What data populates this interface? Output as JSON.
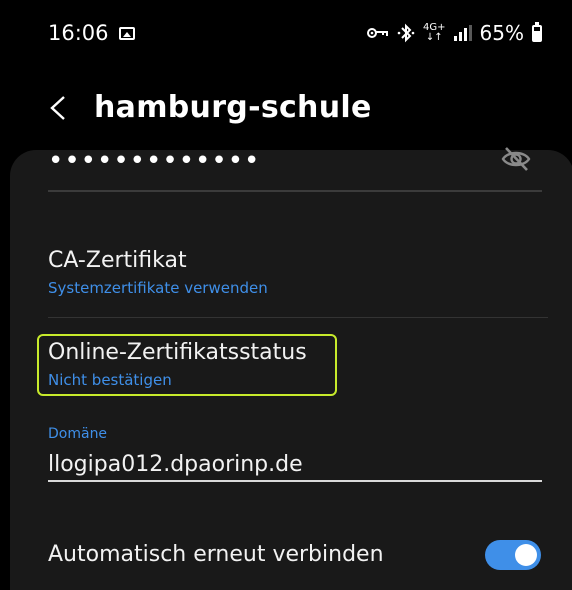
{
  "status_bar": {
    "time": "16:06",
    "battery_percent": "65%",
    "battery_level": 0.65,
    "network_label": "4G+",
    "icons": [
      "image-icon",
      "key-icon",
      "bluetooth-icon",
      "network-icon",
      "signal-icon",
      "battery-icon"
    ]
  },
  "header": {
    "back_icon": "chevron-left-icon",
    "title": "hamburg-schule"
  },
  "password": {
    "masked_value": "•••••••••••••",
    "visibility_icon": "eye-off-icon"
  },
  "ca_certificate": {
    "title": "CA-Zertifikat",
    "value": "Systemzertifikate verwenden"
  },
  "online_cert_status": {
    "title": "Online-Zertifikatsstatus",
    "value": "Nicht bestätigen",
    "highlight_color": "#c7ea2b"
  },
  "domain": {
    "label": "Domäne",
    "value": "llogipa012.dpaorinp.de"
  },
  "auto_reconnect": {
    "label": "Automatisch erneut verbinden",
    "enabled": true
  },
  "colors": {
    "accent": "#3f8fe8",
    "background": "#000000",
    "card": "#191919"
  }
}
